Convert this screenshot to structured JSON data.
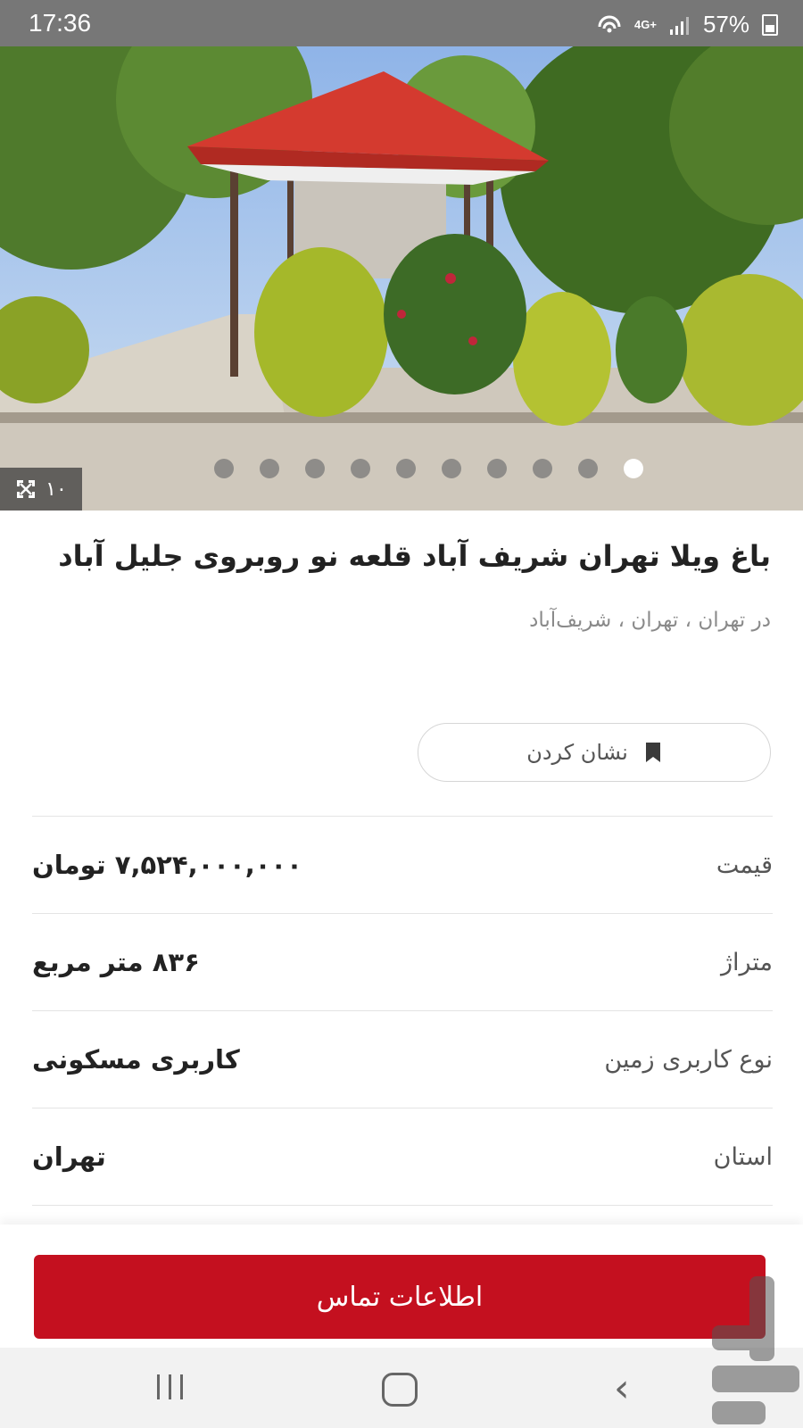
{
  "status_bar": {
    "time": "17:36",
    "network": "4G+",
    "battery_percent": "57%"
  },
  "gallery": {
    "photo_count": "۱۰",
    "total_slides": 10,
    "active_index": 9
  },
  "listing": {
    "title": "باغ ویلا تهران شریف آباد قلعه نو روبروی جلیل آباد",
    "location": "در تهران ، تهران ، شریف‌آباد"
  },
  "actions": {
    "bookmark_label": "نشان کردن",
    "contact_label": "اطلاعات تماس"
  },
  "details": [
    {
      "label": "قیمت",
      "value": "۷,۵۲۴,۰۰۰,۰۰۰ تومان"
    },
    {
      "label": "متراژ",
      "value": "۸۳۶ متر مربع"
    },
    {
      "label": "نوع کاربری زمین",
      "value": "کاربری مسکونی"
    },
    {
      "label": "استان",
      "value": "تهران"
    }
  ],
  "colors": {
    "accent": "#c4101f",
    "status_bar": "#777777",
    "nav_bar": "#f2f2f2"
  },
  "icons": [
    "wifi-calling-icon",
    "signal-icon",
    "battery-icon",
    "expand-icon",
    "bookmark-icon",
    "recent-apps-icon",
    "home-icon",
    "back-icon"
  ]
}
